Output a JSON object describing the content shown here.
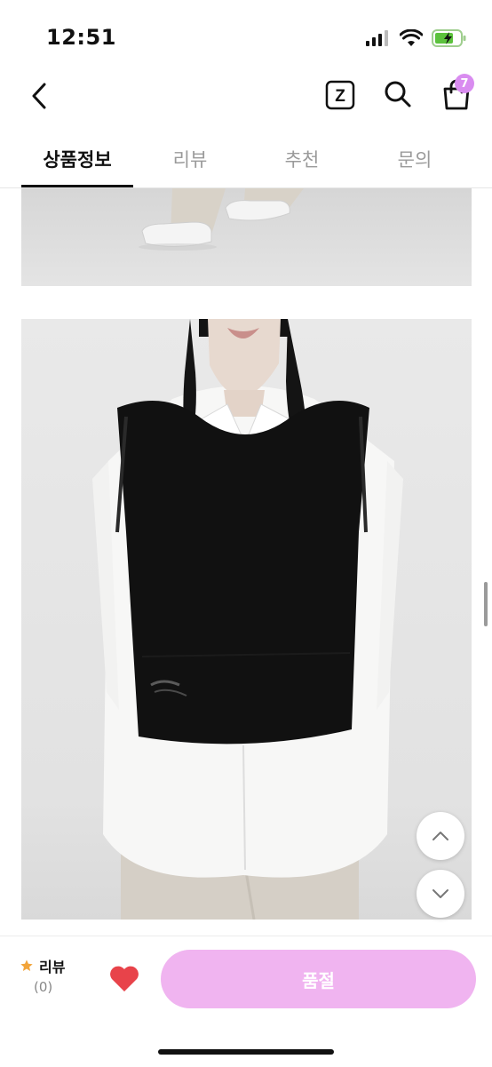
{
  "status_bar": {
    "time": "12:51"
  },
  "header": {
    "back_icon": "chevron-left-icon",
    "z_icon": "z-square-icon",
    "z_label": "Z",
    "search_icon": "search-icon",
    "cart_icon": "shopping-bag-icon",
    "cart_count": "7"
  },
  "tabs": [
    {
      "label": "상품정보",
      "active": true
    },
    {
      "label": "리뷰",
      "active": false
    },
    {
      "label": "추천",
      "active": false
    },
    {
      "label": "문의",
      "active": false
    }
  ],
  "scroll_buttons": {
    "up_icon": "chevron-up-icon",
    "down_icon": "chevron-down-icon"
  },
  "bottom_bar": {
    "review_label": "리뷰",
    "review_count": "(0)",
    "star_icon": "star-icon",
    "heart_icon": "heart-icon",
    "soldout_label": "품절"
  },
  "colors": {
    "accent": "#d98cf0",
    "soldout_button": "#f0b4f0",
    "heart": "#e8434a",
    "star": "#f2a43a"
  }
}
